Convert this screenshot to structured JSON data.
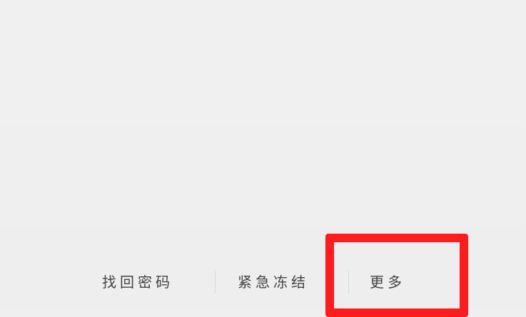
{
  "bottom_links": {
    "retrieve_password": "找回密码",
    "emergency_freeze": "紧急冻结",
    "more": "更多"
  },
  "colors": {
    "background": "#efefef",
    "text": "#2c2c2c",
    "highlight": "#ff1c1c"
  }
}
